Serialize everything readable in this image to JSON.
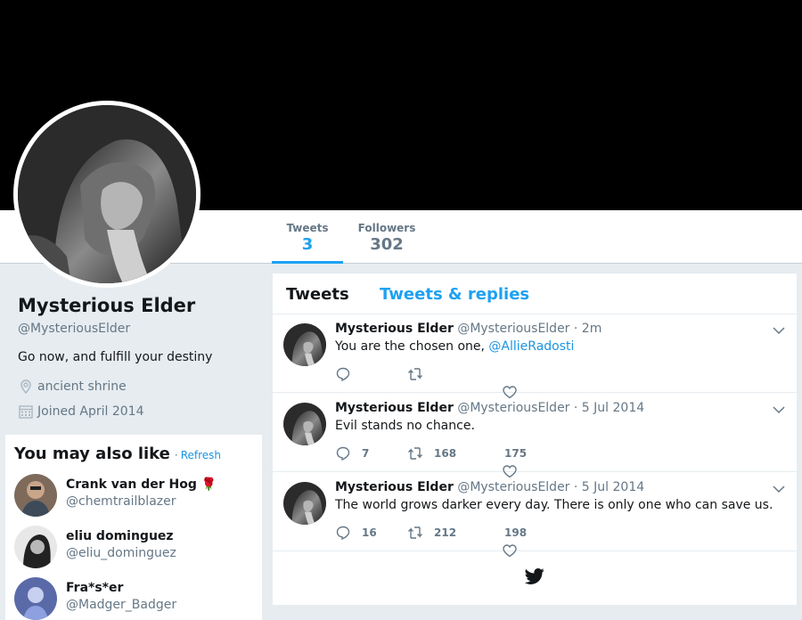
{
  "profile": {
    "name": "Mysterious Elder",
    "handle": "@MysteriousElder",
    "bio": "Go now, and fulfill your destiny",
    "location": "ancient shrine",
    "joined": "Joined April 2014"
  },
  "stats": {
    "tweets_label": "Tweets",
    "tweets_value": "3",
    "followers_label": "Followers",
    "followers_value": "302"
  },
  "who_to_follow": {
    "title": "You may also like",
    "separator": "·",
    "refresh": "Refresh",
    "users": [
      {
        "name": "Crank van der Hog",
        "emoji": "🌹",
        "handle": "@chemtrailblazer"
      },
      {
        "name": "eliu dominguez",
        "handle": "@eliu_dominguez"
      },
      {
        "name": "Fra*s*er",
        "handle": "@Madger_Badger"
      }
    ]
  },
  "timeline": {
    "tabs": {
      "tweets": "Tweets",
      "replies": "Tweets & replies"
    },
    "tweets": [
      {
        "name": "Mysterious Elder",
        "handle": "@MysteriousElder",
        "time": "· 2m",
        "text": "You are the chosen one, ",
        "mention": "@AllieRadosti",
        "replies": "",
        "retweets": "",
        "likes": ""
      },
      {
        "name": "Mysterious Elder",
        "handle": "@MysteriousElder",
        "time": "· 5 Jul 2014",
        "text": "Evil stands no chance.",
        "mention": "",
        "replies": "7",
        "retweets": "168",
        "likes": "175"
      },
      {
        "name": "Mysterious Elder",
        "handle": "@MysteriousElder",
        "time": "· 5 Jul 2014",
        "text": "The world grows darker every day. There is only one who can save us.",
        "mention": "",
        "replies": "16",
        "retweets": "212",
        "likes": "198"
      }
    ]
  },
  "colors": {
    "accent": "#1da1f2",
    "link": "#1b95e0",
    "muted": "#657786",
    "background": "#e6ecf0"
  },
  "icons": [
    "location-icon",
    "calendar-icon",
    "reply-icon",
    "retweet-icon",
    "heart-icon",
    "chevron-down-icon",
    "twitter-bird-icon"
  ]
}
